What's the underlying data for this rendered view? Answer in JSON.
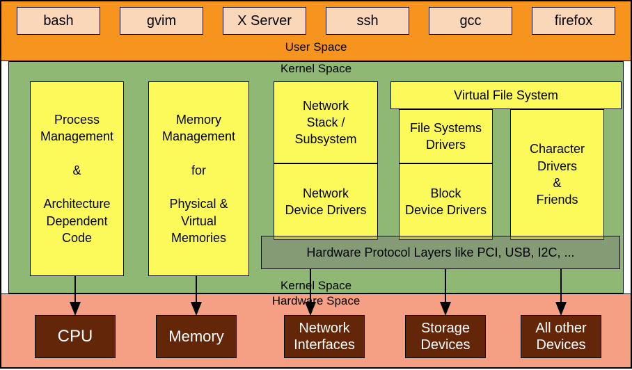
{
  "user_space": {
    "label": "User Space",
    "apps": [
      "bash",
      "gvim",
      "X Server",
      "ssh",
      "gcc",
      "firefox"
    ]
  },
  "kernel_space": {
    "label_top": "Kernel Space",
    "label_bottom": "Kernel Space",
    "process_mgmt": "Process\nManagement\n\n&\n\nArchitecture\nDependent\nCode",
    "memory_mgmt": "Memory\nManagement\n\nfor\n\nPhysical &\nVirtual\nMemories",
    "net_stack": "Network\nStack /\nSubsystem",
    "net_drivers": "Network\nDevice Drivers",
    "vfs": "Virtual File System",
    "fs_drivers": "File Systems\nDrivers",
    "block_drivers": "Block\nDevice Drivers",
    "char_drivers": "Character\nDrivers\n&\nFriends",
    "hw_protocol": "Hardware Protocol Layers like PCI, USB, I2C, ..."
  },
  "hardware_space": {
    "label": "Hardware Space",
    "cpu": "CPU",
    "memory": "Memory",
    "net": "Network\nInterfaces",
    "storage": "Storage\nDevices",
    "other": "All other\nDevices"
  }
}
